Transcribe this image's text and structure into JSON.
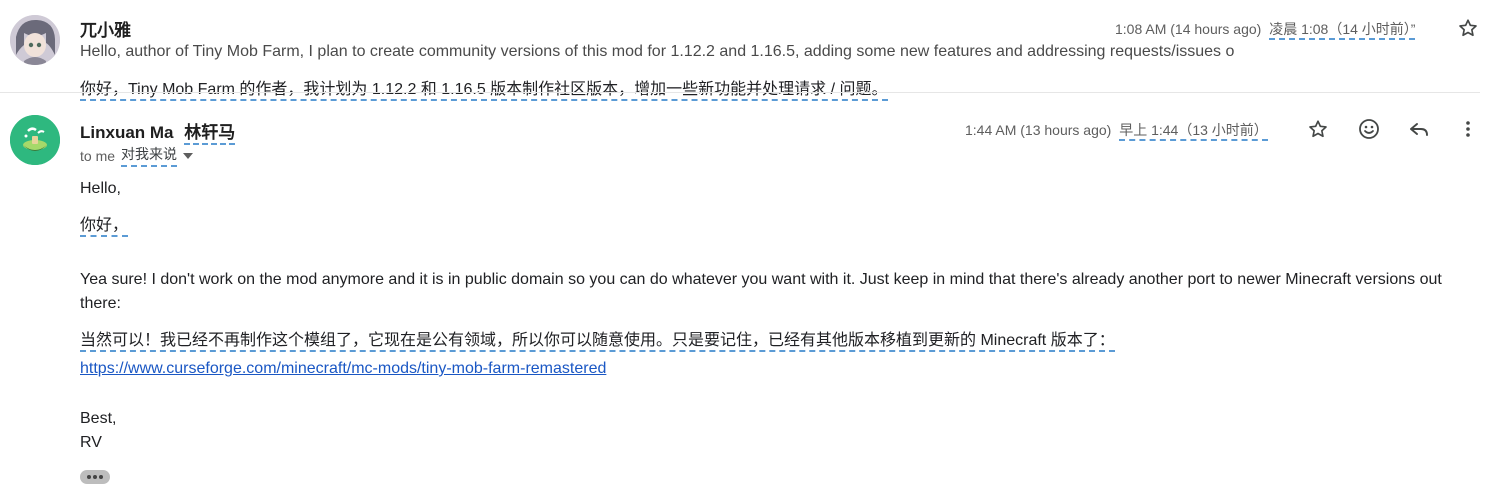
{
  "message1": {
    "sender_name": "兀小雅",
    "timestamp": "1:08 AM (14 hours ago)",
    "timestamp_translated": "凌晨 1:08（14 小时前）”",
    "snippet": "Hello, author of Tiny Mob Farm, I plan to create community versions of this mod for 1.12.2 and 1.16.5, adding some new features and addressing requests/issues o",
    "snippet_translated": "你好，Tiny Mob Farm 的作者，我计划为 1.12.2 和 1.16.5 版本制作社区版本，增加一些新功能并处理请求 / 问题。"
  },
  "message2": {
    "sender_name": "Linxuan Ma",
    "sender_name_translated": "林轩马",
    "recipient_label": "to me",
    "recipient_label_translated": "对我来说",
    "timestamp": "1:44 AM (13 hours ago)",
    "timestamp_translated": "早上 1:44（13 小时前）",
    "greeting": "Hello,",
    "greeting_translated": "你好，",
    "paragraph": "Yea sure! I don't work on the mod anymore and it is in public domain so you can do whatever you want with it. Just keep in mind that there's already another port to newer Minecraft versions out there:",
    "paragraph_translated": "当然可以！我已经不再制作这个模组了，它现在是公有领域，所以你可以随意使用。只是要记住，已经有其他版本移植到更新的 Minecraft 版本了：",
    "link": "https://www.curseforge.com/minecraft/mc-mods/tiny-mob-farm-remastered",
    "signoff": "Best,",
    "signature": "RV"
  },
  "icons": [
    "star-icon",
    "emoji-icon",
    "reply-icon",
    "more-vert-icon",
    "dropdown-arrow-icon",
    "show-trimmed-icon"
  ],
  "colors": {
    "link": "#1a57c4",
    "translation_underline": "#5b9bd5",
    "avatar2_bg": "#2eb87f"
  }
}
